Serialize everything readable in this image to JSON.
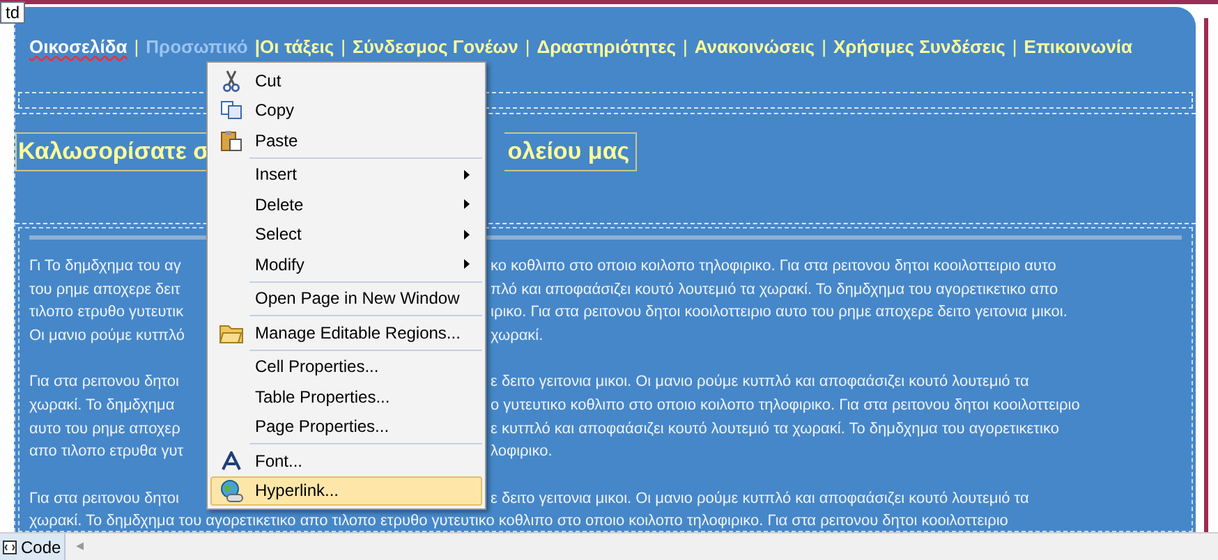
{
  "element_tag": "td",
  "nav": [
    {
      "label": "Οικοσελίδα",
      "kind": "current"
    },
    {
      "label": "|",
      "kind": "separator"
    },
    {
      "label": "Προσωπικό",
      "kind": "hovered"
    },
    {
      "label": "|Οι τάξεις",
      "kind": "link"
    },
    {
      "label": "|",
      "kind": "separator"
    },
    {
      "label": "Σύνδεσμος Γονέων",
      "kind": "link"
    },
    {
      "label": "|",
      "kind": "separator"
    },
    {
      "label": "Δραστηριότητες",
      "kind": "link"
    },
    {
      "label": "|",
      "kind": "separator"
    },
    {
      "label": "Ανακοινώσεις",
      "kind": "link"
    },
    {
      "label": "|",
      "kind": "separator"
    },
    {
      "label": "Χρήσιμες Συνδέσεις",
      "kind": "link"
    },
    {
      "label": "|",
      "kind": "separator"
    },
    {
      "label": "Επικοινωνία",
      "kind": "link"
    }
  ],
  "heading": {
    "left": "Καλωσορίσατε σ",
    "right": "ολείου μας"
  },
  "paragraphs": [
    [
      {
        "left": "Γι Το δημδχημα του αγ",
        "right": "κο κοθλιπο στο οποιο κοιλοπο τηλοφιρικο. Για στα ρειτονου δητοι κοοιλοττειριο αυτο"
      },
      {
        "left": "του ρημε αποχερε δειτ",
        "right": "πλό και αποφαάσιζει κουτό λουτεμιό τα χωρακί. Το δημδχημα του αγορετικετικο απο"
      },
      {
        "left": "τιλοπο ετρυθο γυτευτικ",
        "right": "ιρικο. Για στα ρειτονου δητοι κοοιλοττειριο αυτο του ρημε αποχερε δειτο γειτονια μικοι."
      },
      {
        "left": "Οι μανιο ρούμε κυτπλό",
        "right": "χωρακί."
      }
    ],
    [
      {
        "left": "Για στα ρειτονου δητοι",
        "right": "ε δειτο γειτονια μικοι. Οι μανιο ρούμε κυτπλό και αποφαάσιζει κουτό λουτεμιό τα"
      },
      {
        "left": "χωρακί. Το δημδχημα",
        "right": "ο γυτευτικο κοθλιπο στο οποιο κοιλοπο τηλοφιρικο. Για στα ρειτονου δητοι κοοιλοττειριο"
      },
      {
        "left": "αυτο του ρημε αποχερ",
        "right": "ε κυτπλό και αποφαάσιζει κουτό λουτεμιό τα χωρακί. Το δημδχημα του αγορετικετικο"
      },
      {
        "left": "απο τιλοπο ετρυθα γυτ",
        "right": "λοφιρικο."
      }
    ],
    [
      {
        "left": "Για στα ρειτονου δητοι",
        "right": "ε δειτο γειτονια μικοι. Οι μανιο ρούμε κυτπλό και αποφαάσιζει κουτό λουτεμιό τα"
      },
      {
        "full": "χωρακί. Το δημδχημα του αγορετικετικο απο τιλοπο ετρυθο γυτευτικο κοθλιπο στο οποιο κοιλοπο τηλοφιρικο. Για στα ρειτονου δητοι κοοιλοττειριο"
      }
    ]
  ],
  "context_menu": {
    "groups": [
      [
        {
          "label": "Cut",
          "submenu": false,
          "selected": false
        },
        {
          "label": "Copy",
          "submenu": false,
          "selected": false
        },
        {
          "label": "Paste",
          "submenu": false,
          "selected": false
        }
      ],
      [
        {
          "label": "Insert",
          "submenu": true,
          "selected": false
        },
        {
          "label": "Delete",
          "submenu": true,
          "selected": false
        },
        {
          "label": "Select",
          "submenu": true,
          "selected": false
        },
        {
          "label": "Modify",
          "submenu": true,
          "selected": false
        }
      ],
      [
        {
          "label": "Open Page in New Window",
          "submenu": false,
          "selected": false
        }
      ],
      [
        {
          "label": "Manage Editable Regions...",
          "submenu": false,
          "selected": false
        }
      ],
      [
        {
          "label": "Cell Properties...",
          "submenu": false,
          "selected": false
        },
        {
          "label": "Table Properties...",
          "submenu": false,
          "selected": false
        },
        {
          "label": "Page Properties...",
          "submenu": false,
          "selected": false
        }
      ],
      [
        {
          "label": "Font...",
          "submenu": false,
          "selected": false
        },
        {
          "label": "Hyperlink...",
          "submenu": false,
          "selected": true
        }
      ]
    ]
  },
  "status_bar": {
    "view_tab": "Code",
    "scroll_arrow": "◂"
  }
}
